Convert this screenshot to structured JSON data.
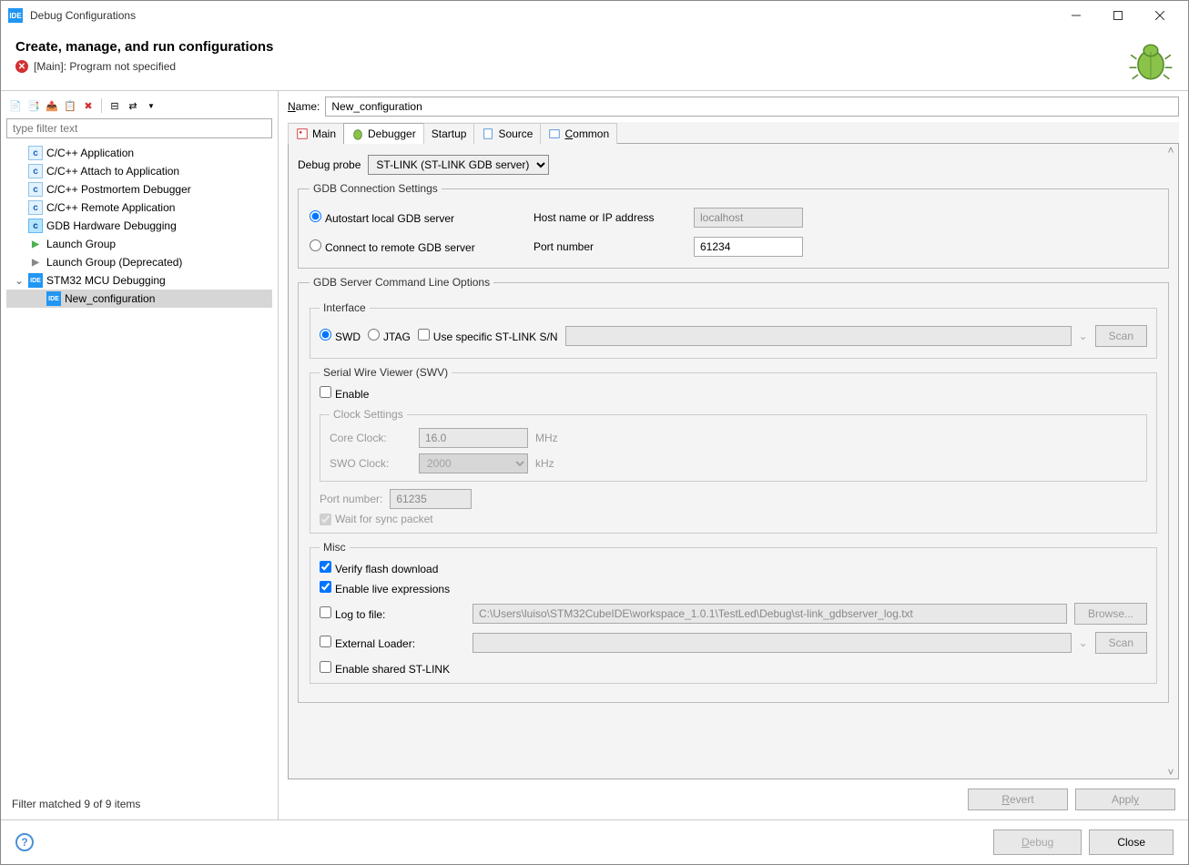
{
  "window": {
    "title": "Debug Configurations"
  },
  "header": {
    "title": "Create, manage, and run configurations",
    "error": "[Main]: Program not specified"
  },
  "left": {
    "filter_placeholder": "type filter text",
    "tree": [
      {
        "label": "C/C++ Application"
      },
      {
        "label": "C/C++ Attach to Application"
      },
      {
        "label": "C/C++ Postmortem Debugger"
      },
      {
        "label": "C/C++ Remote Application"
      },
      {
        "label": "GDB Hardware Debugging"
      },
      {
        "label": "Launch Group"
      },
      {
        "label": "Launch Group (Deprecated)"
      },
      {
        "label": "STM32 MCU Debugging"
      },
      {
        "label": "New_configuration"
      }
    ],
    "filter_status": "Filter matched 9 of 9 items"
  },
  "right": {
    "name_label": "Name:",
    "name_value": "New_configuration",
    "tabs": {
      "main": "Main",
      "debugger": "Debugger",
      "startup": "Startup",
      "source": "Source",
      "common": "Common"
    },
    "debug_probe_label": "Debug probe",
    "debug_probe_value": "ST-LINK (ST-LINK GDB server)",
    "gdb_conn": {
      "legend": "GDB Connection Settings",
      "autostart": "Autostart local GDB server",
      "connect_remote": "Connect to remote GDB server",
      "host_label": "Host name or IP address",
      "host_value": "localhost",
      "port_label": "Port number",
      "port_value": "61234"
    },
    "gdb_server": {
      "legend": "GDB Server Command Line Options",
      "interface_legend": "Interface",
      "swd": "SWD",
      "jtag": "JTAG",
      "use_sn": "Use specific ST-LINK S/N",
      "scan": "Scan",
      "swv_legend": "Serial Wire Viewer (SWV)",
      "enable": "Enable",
      "clock_legend": "Clock Settings",
      "core_clock_label": "Core Clock:",
      "core_clock_value": "16.0",
      "core_clock_unit": "MHz",
      "swo_clock_label": "SWO Clock:",
      "swo_clock_value": "2000",
      "swo_clock_unit": "kHz",
      "swv_port_label": "Port number:",
      "swv_port_value": "61235",
      "wait_sync": "Wait for sync packet",
      "misc_legend": "Misc",
      "verify_flash": "Verify flash download",
      "enable_live": "Enable live expressions",
      "log_to_file": "Log to file:",
      "log_path": "C:\\Users\\luiso\\STM32CubeIDE\\workspace_1.0.1\\TestLed\\Debug\\st-link_gdbserver_log.txt",
      "browse": "Browse...",
      "external_loader": "External Loader:",
      "ext_scan": "Scan",
      "enable_shared": "Enable shared ST-LINK"
    },
    "revert": "Revert",
    "apply": "Apply"
  },
  "footer": {
    "debug": "Debug",
    "close": "Close"
  }
}
